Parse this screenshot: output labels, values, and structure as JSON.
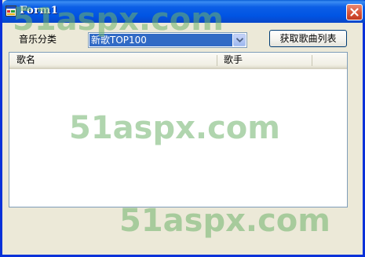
{
  "window": {
    "title": "Form1",
    "icon": "app-window-icon",
    "close_icon": "close-icon"
  },
  "toolbar": {
    "category_label": "音乐分类",
    "category_value": "新歌TOP100",
    "fetch_button_label": "获取歌曲列表"
  },
  "list": {
    "columns": [
      "歌名",
      "歌手"
    ],
    "rows": []
  },
  "watermark": {
    "text": "51aspx.com"
  },
  "colors": {
    "title_bar": "#0054e3",
    "close_button": "#d9573c",
    "selected_item": "#316ac5",
    "watermark": "#70b26c"
  }
}
